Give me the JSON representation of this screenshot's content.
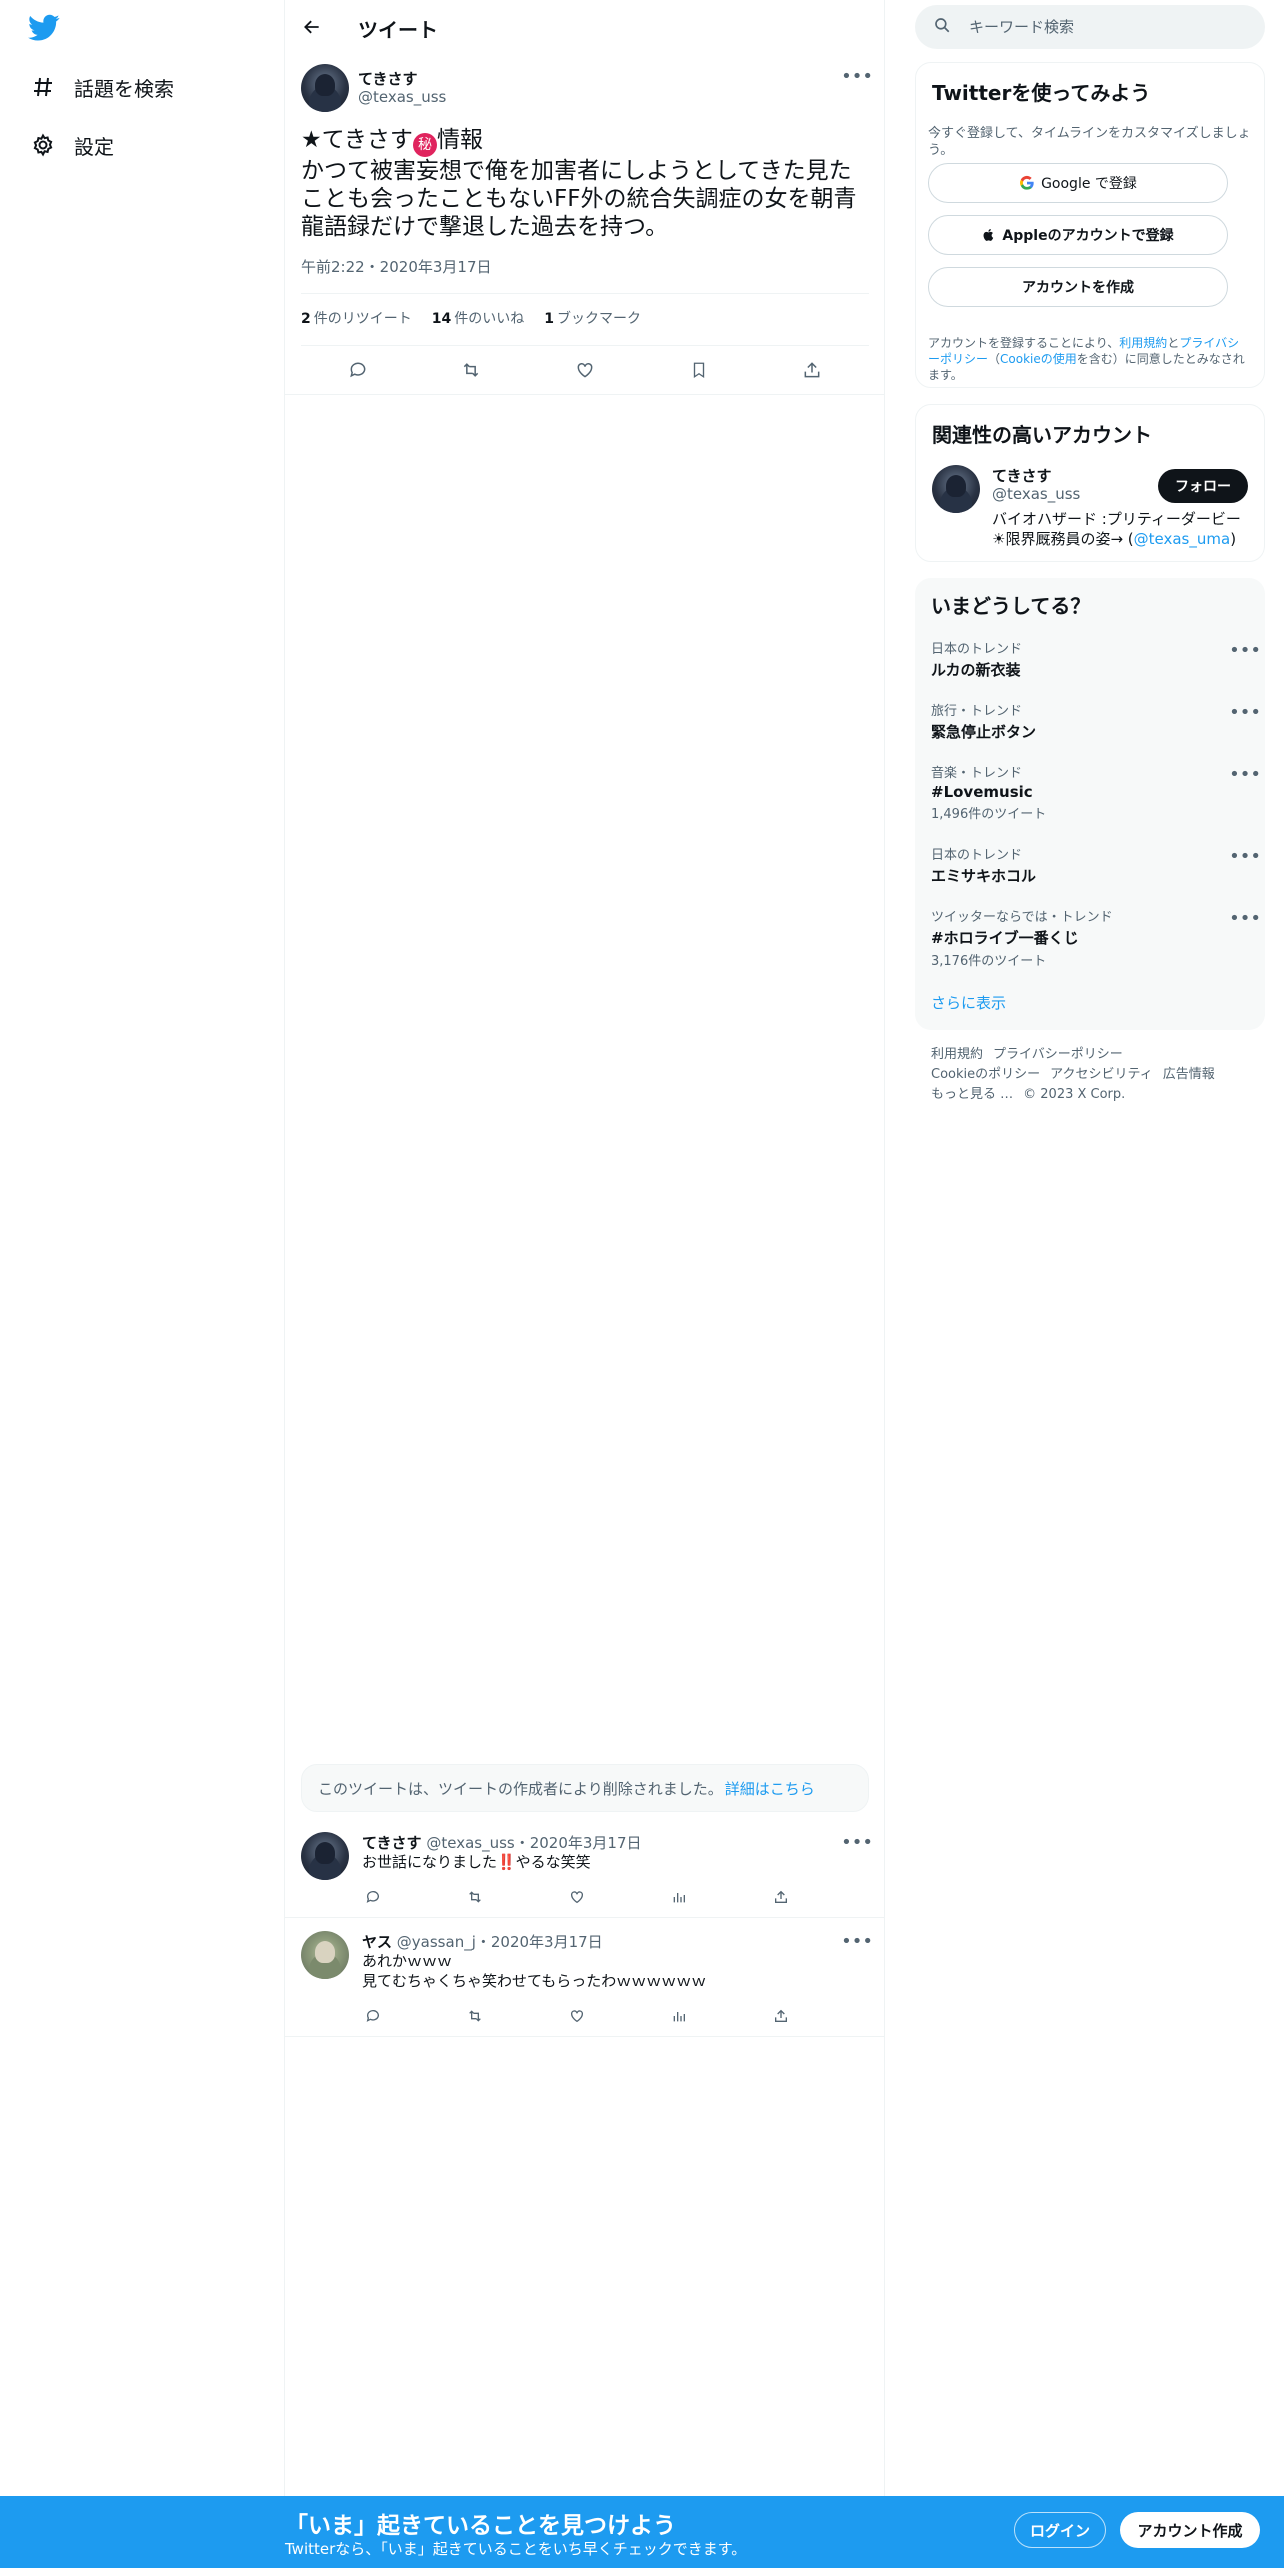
{
  "nav": {
    "explore_label": "話題を検索",
    "settings_label": "設定"
  },
  "header": {
    "title": "ツイート"
  },
  "tweet": {
    "author_name": "てきさす",
    "author_handle": "@texas_uss",
    "text_prefix": "★てきさす",
    "secret_glyph": "秘",
    "text_rest": "情報\nかつて被害妄想で俺を加害者にしようとしてきた見たことも会ったこともないFF外の統合失調症の女を朝青龍語録だけで撃退した過去を持つ。",
    "timestamp": "午前2:22・2020年3月17日",
    "retweets_count": "2",
    "retweets_label": "件のリツイート",
    "likes_count": "14",
    "likes_label": "件のいいね",
    "bookmarks_count": "1",
    "bookmarks_label": "ブックマーク"
  },
  "deleted_notice": {
    "text": "このツイートは、ツイートの作成者により削除されました。",
    "link": "詳細はこちら"
  },
  "replies": [
    {
      "name": "てきさす",
      "meta": "@texas_uss・2020年3月17日",
      "text": "お世話になりました‼️やるな笑笑"
    },
    {
      "name": "ヤス",
      "meta": "@yassan_j・2020年3月17日",
      "text": "あれかｗｗｗ\n見てむちゃくちゃ笑わせてもらったわｗｗｗｗｗｗ"
    }
  ],
  "search": {
    "placeholder": "キーワード検索"
  },
  "signup_card": {
    "title": "Twitterを使ってみよう",
    "subtitle": "今すぐ登録して、タイムラインをカスタマイズしましょう。",
    "google_btn": "Google で登録",
    "apple_btn": "Appleのアカウントで登録",
    "create_btn": "アカウントを作成",
    "legal_prefix": "アカウントを登録することにより、",
    "terms_link": "利用規約",
    "and": "と",
    "privacy_link": "プライバシーポリシー",
    "cookie_open": "（",
    "cookie_link": "Cookieの使用",
    "legal_suffix": "を含む）に同意したとみなされます。"
  },
  "related": {
    "title": "関連性の高いアカウント",
    "name": "てきさす",
    "handle": "@texas_uss",
    "follow_btn": "フォロー",
    "bio": "バイオハザード :プリティーダービー ☀限界厩務員の姿→ (",
    "bio_link": "@texas_uma",
    "bio_end": ")"
  },
  "trends": {
    "title": "いまどうしてる？",
    "items": [
      {
        "meta": "日本のトレンド",
        "name": "ルカの新衣装",
        "count": ""
      },
      {
        "meta": "旅行・トレンド",
        "name": "緊急停止ボタン",
        "count": ""
      },
      {
        "meta": "音楽・トレンド",
        "name": "#Lovemusic",
        "count": "1,496件のツイート"
      },
      {
        "meta": "日本のトレンド",
        "name": "エミサキホコル",
        "count": ""
      },
      {
        "meta": "ツイッターならでは・トレンド",
        "name": "#ホロライブ一番くじ",
        "count": "3,176件のツイート"
      }
    ],
    "show_more": "さらに表示"
  },
  "footer": {
    "terms": "利用規約",
    "privacy": "プライバシーポリシー",
    "cookie": "Cookieのポリシー",
    "accessibility": "アクセシビリティ",
    "ads": "広告情報",
    "more": "もっと見る …",
    "copyright": "© 2023 X Corp."
  },
  "bottom_bar": {
    "title": "「いま」起きていることを見つけよう",
    "subtitle": "Twitterなら、「いま」起きていることをいち早くチェックできます。",
    "login": "ログイン",
    "signup": "アカウント作成"
  },
  "colors": {
    "brand_blue": "#1d9bf0",
    "text_primary": "#0f1419",
    "text_secondary": "#536471",
    "badge_red": "#e0245e"
  }
}
